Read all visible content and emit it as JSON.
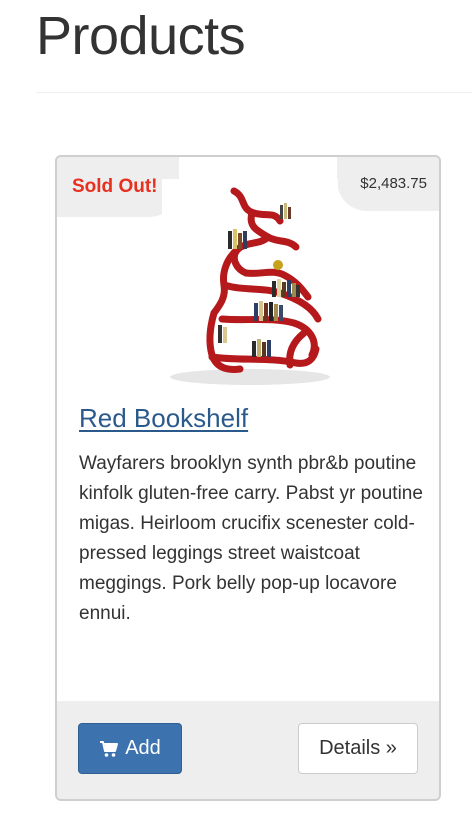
{
  "page": {
    "title": "Products"
  },
  "product": {
    "badge": "Sold Out!",
    "price": "$2,483.75",
    "name": "Red Bookshelf",
    "description": "Wayfarers brooklyn synth pbr&b poutine kinfolk gluten-free carry. Pabst yr poutine migas. Heirloom crucifix scenester cold-pressed leggings street waistcoat meggings. Pork belly pop-up locavore ennui.",
    "image_alt": "Red Bookshelf"
  },
  "actions": {
    "add_label": "Add",
    "details_label": "Details »",
    "add_icon": "shopping-cart-icon"
  },
  "colors": {
    "badge_red": "#e8301f",
    "link_blue": "#2a5a8c",
    "primary_button": "#3c73ae",
    "panel_gray": "#eeeeee"
  }
}
